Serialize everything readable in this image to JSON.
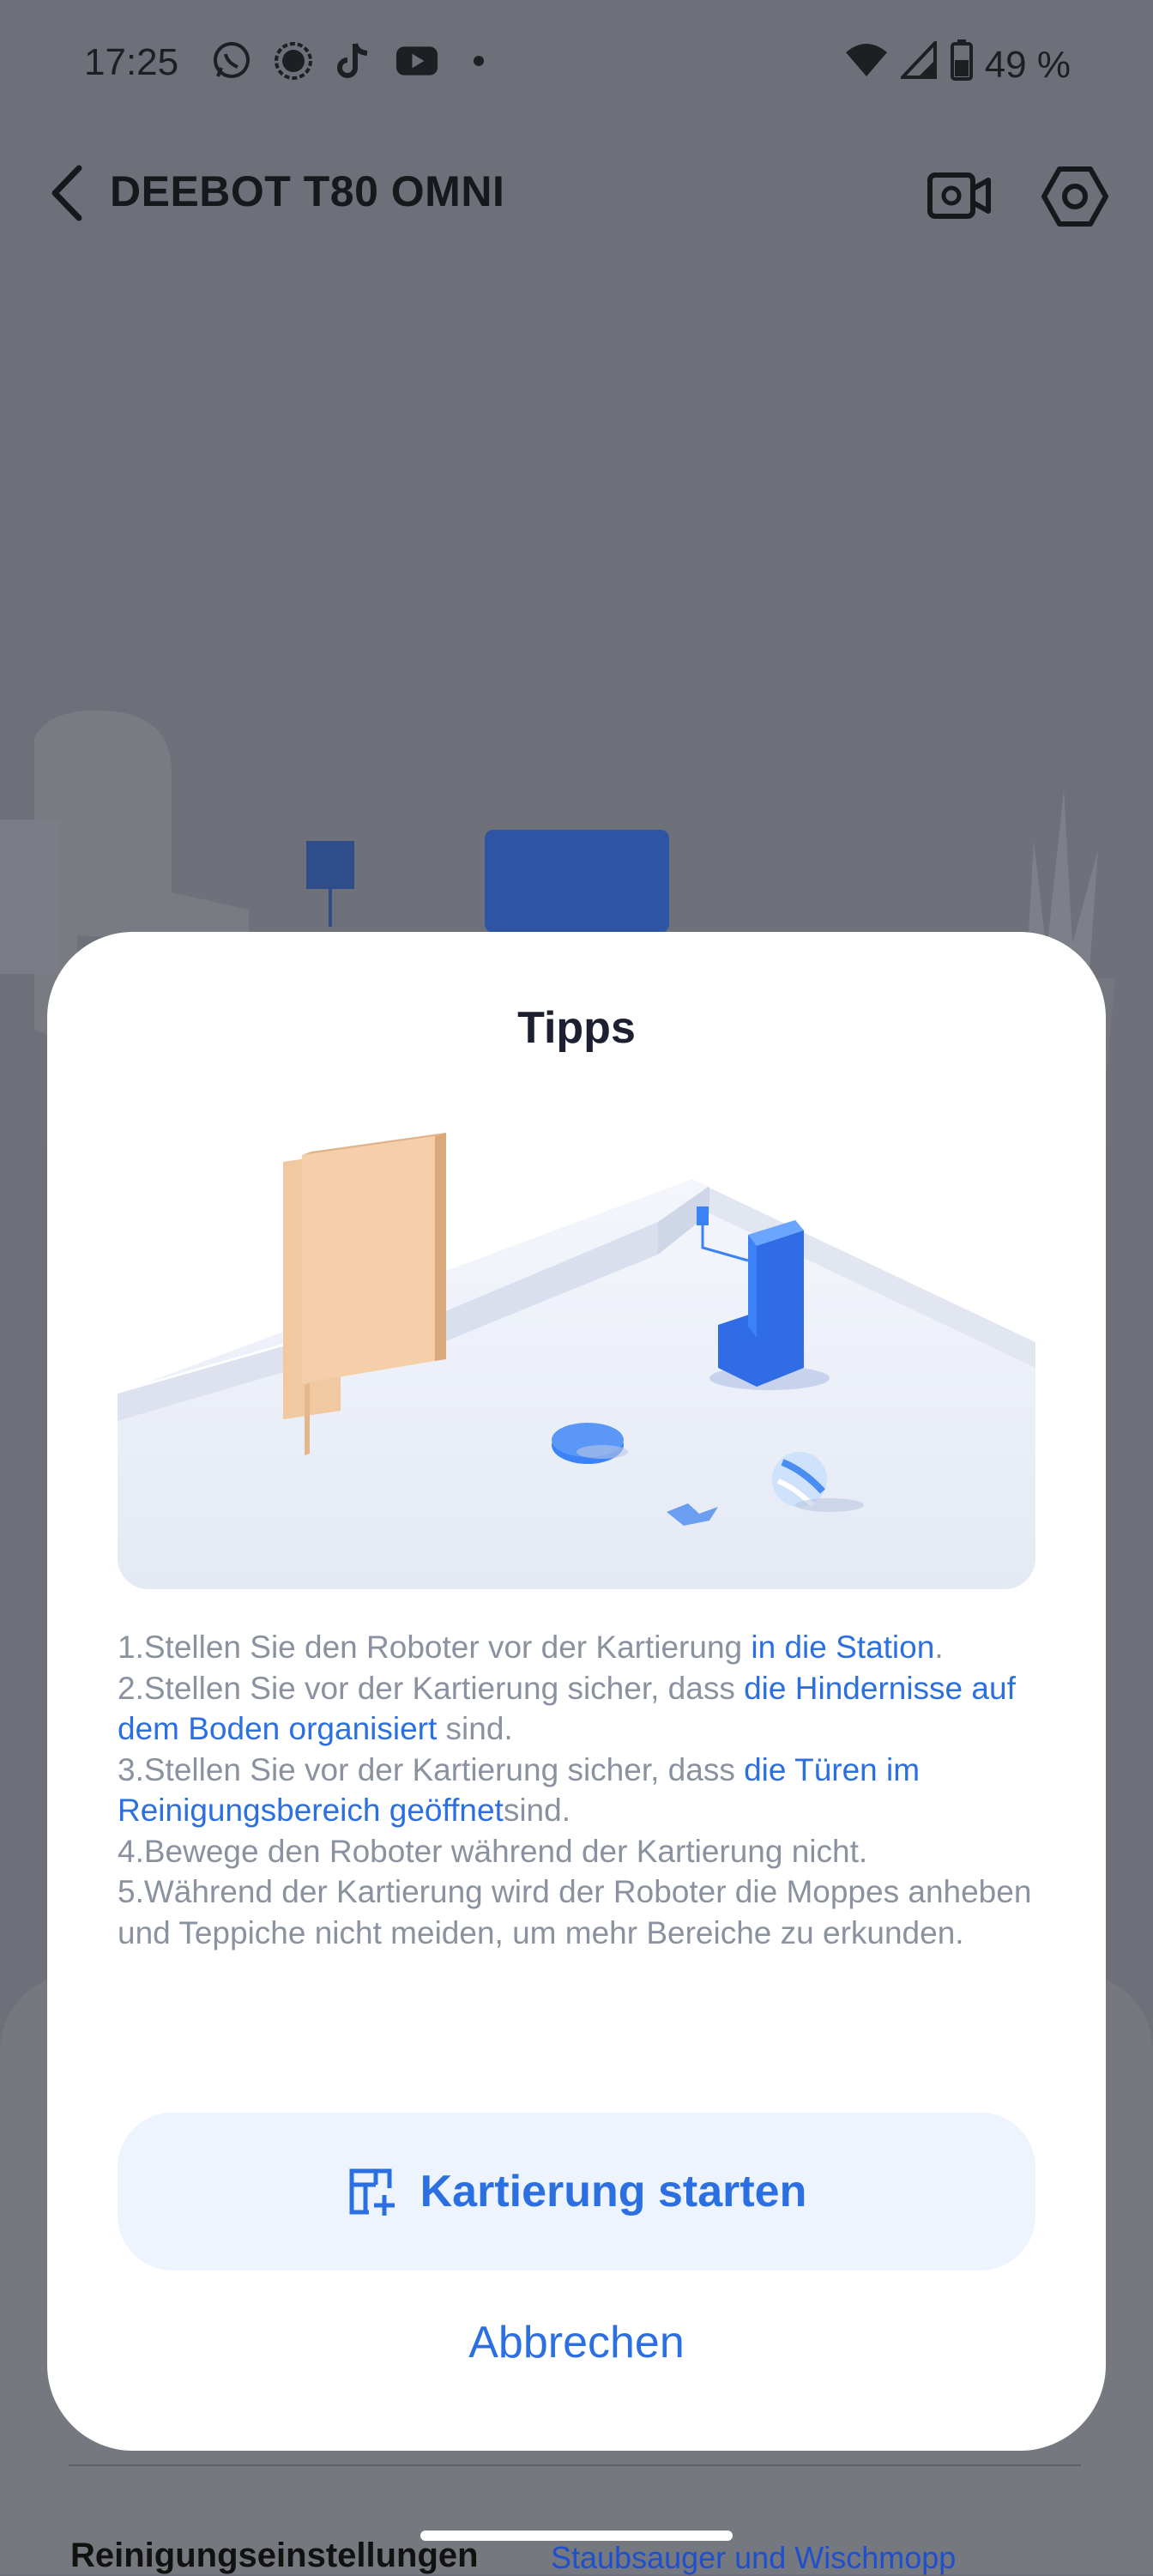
{
  "status_bar": {
    "time": "17:25",
    "apps": [
      "whatsapp-icon",
      "signal-icon",
      "tiktok-icon",
      "youtube-icon",
      "more-dot-icon"
    ],
    "battery_percent": "49 %"
  },
  "app_bar": {
    "title": "DEEBOT T80 OMNI"
  },
  "dialog": {
    "title": "Tipps",
    "tips": [
      {
        "segments": [
          {
            "text": "1.Stellen Sie den Roboter vor der Kartierung ",
            "highlight": false
          },
          {
            "text": "in die Station",
            "highlight": true
          },
          {
            "text": ".",
            "highlight": false
          }
        ]
      },
      {
        "segments": [
          {
            "text": "2.Stellen Sie vor der Kartierung sicher, dass ",
            "highlight": false
          },
          {
            "text": "die Hindernisse auf dem Boden organisiert",
            "highlight": true
          },
          {
            "text": " sind.",
            "highlight": false
          }
        ]
      },
      {
        "segments": [
          {
            "text": "3.Stellen Sie vor der Kartierung sicher, dass ",
            "highlight": false
          },
          {
            "text": "die Türen im Reinigungsbereich geöffnet",
            "highlight": true
          },
          {
            "text": "sind.",
            "highlight": false
          }
        ]
      },
      {
        "segments": [
          {
            "text": "4.Bewege den Roboter während der Kartierung nicht.",
            "highlight": false
          }
        ]
      },
      {
        "segments": [
          {
            "text": "5.Während der Kartierung wird der Roboter die Moppes anheben und Teppiche nicht meiden, um mehr Bereiche zu erkunden.",
            "highlight": false
          }
        ]
      }
    ],
    "start_button": "Kartierung starten",
    "cancel_button": "Abbrechen"
  },
  "background": {
    "cleaning_settings": "Reinigungseinstellungen",
    "cleaning_mode": "Staubsauger und Wischmopp"
  },
  "colors": {
    "accent": "#2b6fe0",
    "tip_text": "#8a919f",
    "overlay": "#6d7079",
    "button_bg": "#eef4fd"
  }
}
